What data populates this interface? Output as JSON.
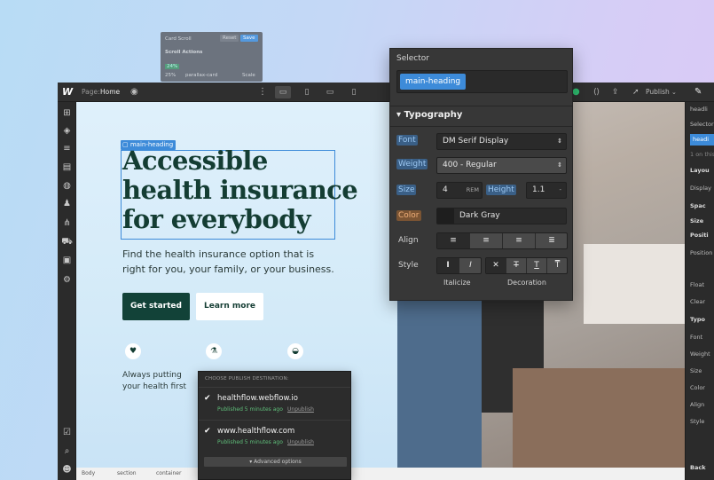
{
  "card_scroll": {
    "title": "Card Scroll",
    "reset": "Reset",
    "save": "Save",
    "actions": "Scroll Actions",
    "percent": "24%",
    "percent2": "25%",
    "item": "parallax-card",
    "scale": "Scale"
  },
  "topbar": {
    "logo": "W",
    "page_label": "Page:",
    "page_name": "Home",
    "publish": "Publish"
  },
  "selector": {
    "title": "Selector",
    "tag": "main-heading"
  },
  "typography": {
    "section": "Typography",
    "font_label": "Font",
    "font_value": "DM Serif Display",
    "weight_label": "Weight",
    "weight_value": "400 - Regular",
    "size_label": "Size",
    "size_value": "4",
    "size_unit": "REM",
    "height_label": "Height",
    "height_value": "1.1",
    "height_unit": "-",
    "color_label": "Color",
    "color_value": "Dark Gray",
    "color_hex": "#1e1e1e",
    "align_label": "Align",
    "style_label": "Style",
    "italicize": "Italicize",
    "decoration": "Decoration"
  },
  "hero": {
    "badge": "main-heading",
    "heading_lines": [
      "Accessible",
      "health insurance",
      "for everybody"
    ],
    "subtext": "Find the health insurance option that is right for you, your family, or your business.",
    "btn_primary": "Get started",
    "btn_secondary": "Learn more",
    "feature_line1": "Always putting",
    "feature_line2": "your health first"
  },
  "publish_popup": {
    "header": "CHOOSE PUBLISH DESTINATION:",
    "destinations": [
      {
        "domain": "healthflow.webflow.io",
        "status": "Published 5 minutes ago",
        "action": "Unpublish"
      },
      {
        "domain": "www.healthflow.com",
        "status": "Published 5 minutes ago",
        "action": "Unpublish"
      }
    ],
    "advanced": "Advanced options"
  },
  "breadcrumb": [
    "Body",
    "section",
    "container"
  ],
  "right_panel": {
    "element": "headli",
    "selector_label": "Selector",
    "selector_tag": "headi",
    "on_this": "1 on this",
    "sections": [
      "Layou",
      "Display",
      "Spac",
      "Size",
      "Positi",
      "Position",
      "Float",
      "Clear",
      "Typo",
      "Font",
      "Weight",
      "Size",
      "Color",
      "Align",
      "Style",
      "Back"
    ]
  },
  "colors": {
    "brand": "#124238",
    "accent": "#3d8bd9"
  }
}
